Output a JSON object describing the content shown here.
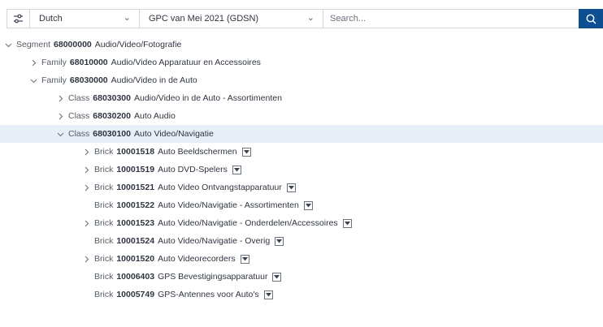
{
  "toolbar": {
    "filter_icon": "sliders-icon",
    "language": "Dutch",
    "gpc_version": "GPC van Mei 2021 (GDSN)",
    "search_placeholder": "Search...",
    "search_icon": "search-icon"
  },
  "colors": {
    "accent": "#0e4f91",
    "selected_row": "#e7eef8",
    "border": "#cfd6de"
  },
  "tree": [
    {
      "level": 0,
      "chevron": "down",
      "type": "Segment",
      "code": "68000000",
      "name": "Audio/Video/Fotografie",
      "dropdown": false,
      "selected": false
    },
    {
      "level": 1,
      "chevron": "right",
      "type": "Family",
      "code": "68010000",
      "name": "Audio/Video Apparatuur en Accessoires",
      "dropdown": false,
      "selected": false
    },
    {
      "level": 1,
      "chevron": "down",
      "type": "Family",
      "code": "68030000",
      "name": "Audio/Video in de Auto",
      "dropdown": false,
      "selected": false
    },
    {
      "level": 2,
      "chevron": "right",
      "type": "Class",
      "code": "68030300",
      "name": "Audio/Video in de Auto - Assortimenten",
      "dropdown": false,
      "selected": false
    },
    {
      "level": 2,
      "chevron": "right",
      "type": "Class",
      "code": "68030200",
      "name": "Auto Audio",
      "dropdown": false,
      "selected": false
    },
    {
      "level": 2,
      "chevron": "down",
      "type": "Class",
      "code": "68030100",
      "name": "Auto Video/Navigatie",
      "dropdown": false,
      "selected": true
    },
    {
      "level": 3,
      "chevron": "right",
      "type": "Brick",
      "code": "10001518",
      "name": "Auto Beeldschermen",
      "dropdown": true,
      "selected": false
    },
    {
      "level": 3,
      "chevron": "right",
      "type": "Brick",
      "code": "10001519",
      "name": "Auto DVD-Spelers",
      "dropdown": true,
      "selected": false
    },
    {
      "level": 3,
      "chevron": "right",
      "type": "Brick",
      "code": "10001521",
      "name": "Auto Video Ontvangstapparatuur",
      "dropdown": true,
      "selected": false
    },
    {
      "level": 3,
      "chevron": "none",
      "type": "Brick",
      "code": "10001522",
      "name": "Auto Video/Navigatie - Assortimenten",
      "dropdown": true,
      "selected": false
    },
    {
      "level": 3,
      "chevron": "right",
      "type": "Brick",
      "code": "10001523",
      "name": "Auto Video/Navigatie - Onderdelen/Accessoires",
      "dropdown": true,
      "selected": false
    },
    {
      "level": 3,
      "chevron": "none",
      "type": "Brick",
      "code": "10001524",
      "name": "Auto Video/Navigatie - Overig",
      "dropdown": true,
      "selected": false
    },
    {
      "level": 3,
      "chevron": "right",
      "type": "Brick",
      "code": "10001520",
      "name": "Auto Videorecorders",
      "dropdown": true,
      "selected": false
    },
    {
      "level": 3,
      "chevron": "none",
      "type": "Brick",
      "code": "10006403",
      "name": "GPS Bevestigingsapparatuur",
      "dropdown": true,
      "selected": false
    },
    {
      "level": 3,
      "chevron": "none",
      "type": "Brick",
      "code": "10005749",
      "name": "GPS-Antennes voor Auto's",
      "dropdown": true,
      "selected": false
    }
  ]
}
